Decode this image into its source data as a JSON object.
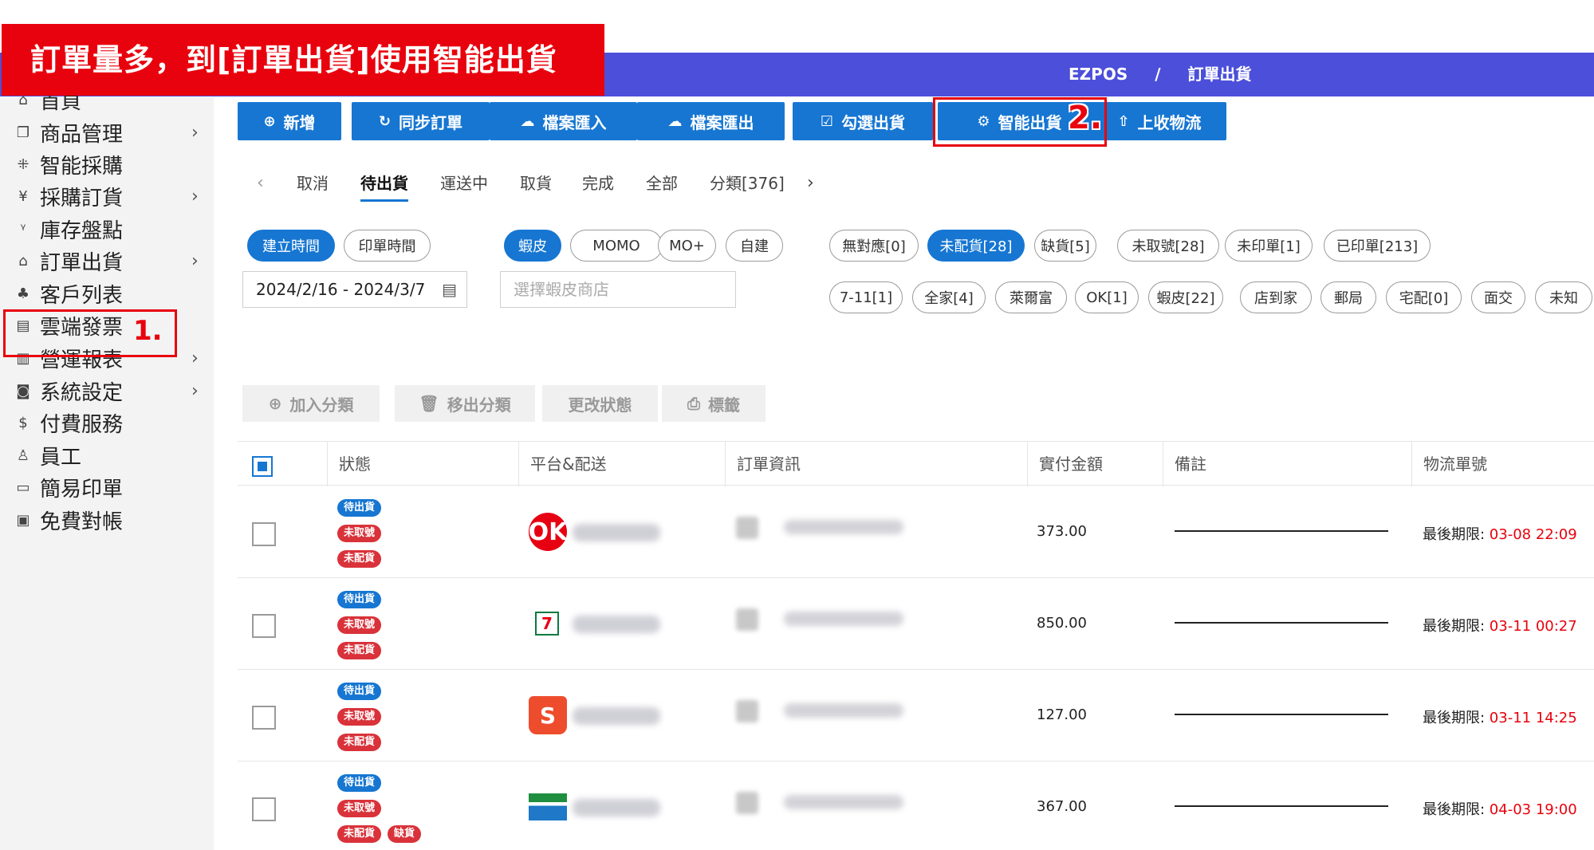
{
  "banner": {
    "text": "訂單量多，到[訂單出貨]使用智能出貨"
  },
  "header": {
    "app": "EZPOS",
    "separator": "/",
    "page": "訂單出貨"
  },
  "sidebar": {
    "items": [
      {
        "icon": "home-icon",
        "glyph": "⌂",
        "label": "首頁",
        "chevron": ""
      },
      {
        "icon": "product-icon",
        "glyph": "❐",
        "label": "商品管理",
        "chevron": "›"
      },
      {
        "icon": "smart-purchase-icon",
        "glyph": "⁜",
        "label": "智能採購",
        "chevron": ""
      },
      {
        "icon": "cart-icon",
        "glyph": "¥",
        "label": "採購訂貨",
        "chevron": "›"
      },
      {
        "icon": "inventory-icon",
        "glyph": "ᵞ",
        "label": "庫存盤點",
        "chevron": ""
      },
      {
        "icon": "shipping-bag-icon",
        "glyph": "⌂",
        "label": "訂單出貨",
        "chevron": "›"
      },
      {
        "icon": "customer-icon",
        "glyph": "♣",
        "label": "客戶列表",
        "chevron": ""
      },
      {
        "icon": "invoice-icon",
        "glyph": "▤",
        "label": "雲端發票",
        "chevron": ""
      },
      {
        "icon": "report-icon",
        "glyph": "▥",
        "label": "營運報表",
        "chevron": "›"
      },
      {
        "icon": "settings-icon",
        "glyph": "◙",
        "label": "系統設定",
        "chevron": "›"
      },
      {
        "icon": "dollar-icon",
        "glyph": "$",
        "label": "付費服務",
        "chevron": ""
      },
      {
        "icon": "staff-icon",
        "glyph": "♙",
        "label": "員工",
        "chevron": ""
      },
      {
        "icon": "print-icon",
        "glyph": "▭",
        "label": "簡易印單",
        "chevron": ""
      },
      {
        "icon": "reconcile-icon",
        "glyph": "▣",
        "label": "免費對帳",
        "chevron": ""
      }
    ],
    "annotation": "1."
  },
  "toolbar": {
    "buttons": [
      {
        "icon": "⊕",
        "label": "新增"
      },
      {
        "icon": "↻",
        "label": "同步訂單"
      },
      {
        "icon": "☁",
        "label": "檔案匯入"
      },
      {
        "icon": "☁",
        "label": "檔案匯出"
      },
      {
        "icon": "☑",
        "label": "勾選出貨"
      },
      {
        "icon": "⚙",
        "label": "智能出貨"
      },
      {
        "icon": "⇧",
        "label": "上收物流"
      }
    ],
    "annotation": "2."
  },
  "tabs": {
    "prev": "‹",
    "next": "›",
    "items": [
      "取消",
      "待出貨",
      "運送中",
      "取貨",
      "完成",
      "全部",
      "分類[376]"
    ]
  },
  "filters": {
    "time": [
      "建立時間",
      "印單時間"
    ],
    "platforms": [
      "蝦皮",
      "MOMO",
      "MO+",
      "自建"
    ],
    "status_row1": [
      "無對應[0]",
      "未配貨[28]",
      "缺貨[5]",
      "未取號[28]",
      "未印單[1]",
      "已印單[213]"
    ],
    "status_row2": [
      "7-11[1]",
      "全家[4]",
      "萊爾富",
      "OK[1]",
      "蝦皮[22]",
      "店到家",
      "郵局",
      "宅配[0]",
      "面交",
      "未知"
    ]
  },
  "date_range": "2024/2/16 - 2024/3/7",
  "shop_placeholder": "選擇蝦皮商店",
  "actions": [
    {
      "icon": "⊕",
      "label": "加入分類"
    },
    {
      "icon": "🗑",
      "label": "移出分類"
    },
    {
      "icon": "",
      "label": "更改狀態"
    },
    {
      "icon": "⎙",
      "label": "標籤"
    }
  ],
  "table": {
    "headers": [
      "狀態",
      "平台&配送",
      "訂單資訊",
      "實付金額",
      "備註",
      "物流單號"
    ],
    "deadline_label": "最後期限: ",
    "rows": [
      {
        "badges": [
          "待出貨",
          "未取號",
          "未配貨"
        ],
        "extra": "",
        "carrier": "OK",
        "amount": "373.00",
        "deadline": "03-08 22:09"
      },
      {
        "badges": [
          "待出貨",
          "未取號",
          "未配貨"
        ],
        "extra": "",
        "carrier": "7-11",
        "amount": "850.00",
        "deadline": "03-11 00:27"
      },
      {
        "badges": [
          "待出貨",
          "未取號",
          "未配貨"
        ],
        "extra": "",
        "carrier": "蝦皮",
        "amount": "127.00",
        "deadline": "03-11 14:25"
      },
      {
        "badges": [
          "待出貨",
          "未取號",
          "未配貨"
        ],
        "extra": "缺貨",
        "carrier": "全家",
        "amount": "367.00",
        "deadline": "04-03 19:00"
      }
    ]
  },
  "colors": {
    "primary": "#1676d2",
    "header": "#4c4fd9",
    "annotation": "#e8020d",
    "badge_red": "#d9323a"
  }
}
